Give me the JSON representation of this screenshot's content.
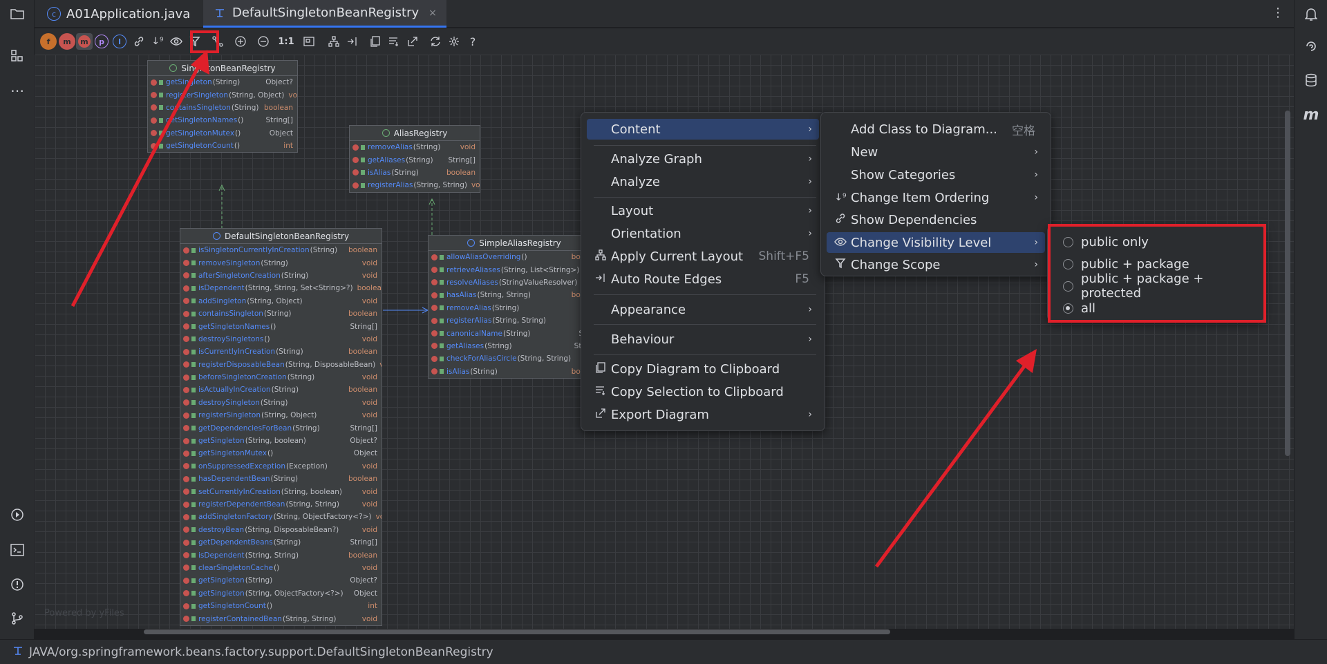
{
  "tabs": [
    {
      "label": "A01Application.java",
      "icon": "java-class-icon"
    },
    {
      "label": "DefaultSingletonBeanRegistry",
      "icon": "diagram-icon",
      "close": "×"
    }
  ],
  "toolbar": {
    "icons": [
      "fields-icon",
      "constructors-icon",
      "methods-icon",
      "properties-icon",
      "inner-classes-icon",
      "link-icon",
      "sort-icon",
      "visibility-icon",
      "filter-icon",
      "route-icon",
      "zoom-in-icon",
      "zoom-out-icon",
      "actual-size-icon",
      "fit-content-icon",
      "layout-icon",
      "route-edges-icon",
      "copy-icon",
      "copy-selection-icon",
      "export-icon",
      "refresh-icon",
      "settings-icon",
      "help-icon"
    ],
    "actual_size_label": "1:1",
    "help_label": "?"
  },
  "watermark": "Powered by yFiles",
  "classes": [
    {
      "name": "SingletonBeanRegistry",
      "kind": "interface",
      "methods": [
        {
          "name": "getSingleton",
          "params": "(String)",
          "ret": "Object?"
        },
        {
          "name": "registerSingleton",
          "params": "(String, Object)",
          "ret": "void"
        },
        {
          "name": "containsSingleton",
          "params": "(String)",
          "ret": "boolean"
        },
        {
          "name": "getSingletonNames",
          "params": "()",
          "ret": "String[]"
        },
        {
          "name": "getSingletonMutex",
          "params": "()",
          "ret": "Object"
        },
        {
          "name": "getSingletonCount",
          "params": "()",
          "ret": "int"
        }
      ]
    },
    {
      "name": "AliasRegistry",
      "kind": "interface",
      "methods": [
        {
          "name": "removeAlias",
          "params": "(String)",
          "ret": "void"
        },
        {
          "name": "getAliases",
          "params": "(String)",
          "ret": "String[]"
        },
        {
          "name": "isAlias",
          "params": "(String)",
          "ret": "boolean"
        },
        {
          "name": "registerAlias",
          "params": "(String, String)",
          "ret": "void"
        }
      ]
    },
    {
      "name": "DefaultSingletonBeanRegistry",
      "kind": "class",
      "methods": [
        {
          "name": "isSingletonCurrentlyInCreation",
          "params": "(String)",
          "ret": "boolean"
        },
        {
          "name": "removeSingleton",
          "params": "(String)",
          "ret": "void"
        },
        {
          "name": "afterSingletonCreation",
          "params": "(String)",
          "ret": "void"
        },
        {
          "name": "isDependent",
          "params": "(String, String, Set<String>?)",
          "ret": "boolean"
        },
        {
          "name": "addSingleton",
          "params": "(String, Object)",
          "ret": "void"
        },
        {
          "name": "containsSingleton",
          "params": "(String)",
          "ret": "boolean"
        },
        {
          "name": "getSingletonNames",
          "params": "()",
          "ret": "String[]"
        },
        {
          "name": "destroySingletons",
          "params": "()",
          "ret": "void"
        },
        {
          "name": "isCurrentlyInCreation",
          "params": "(String)",
          "ret": "boolean"
        },
        {
          "name": "registerDisposableBean",
          "params": "(String, DisposableBean)",
          "ret": "void"
        },
        {
          "name": "beforeSingletonCreation",
          "params": "(String)",
          "ret": "void"
        },
        {
          "name": "isActuallyInCreation",
          "params": "(String)",
          "ret": "boolean"
        },
        {
          "name": "destroySingleton",
          "params": "(String)",
          "ret": "void"
        },
        {
          "name": "registerSingleton",
          "params": "(String, Object)",
          "ret": "void"
        },
        {
          "name": "getDependenciesForBean",
          "params": "(String)",
          "ret": "String[]"
        },
        {
          "name": "getSingleton",
          "params": "(String, boolean)",
          "ret": "Object?"
        },
        {
          "name": "getSingletonMutex",
          "params": "()",
          "ret": "Object"
        },
        {
          "name": "onSuppressedException",
          "params": "(Exception)",
          "ret": "void"
        },
        {
          "name": "hasDependentBean",
          "params": "(String)",
          "ret": "boolean"
        },
        {
          "name": "setCurrentlyInCreation",
          "params": "(String, boolean)",
          "ret": "void"
        },
        {
          "name": "registerDependentBean",
          "params": "(String, String)",
          "ret": "void"
        },
        {
          "name": "addSingletonFactory",
          "params": "(String, ObjectFactory<?>)",
          "ret": "void"
        },
        {
          "name": "destroyBean",
          "params": "(String, DisposableBean?)",
          "ret": "void"
        },
        {
          "name": "getDependentBeans",
          "params": "(String)",
          "ret": "String[]"
        },
        {
          "name": "isDependent",
          "params": "(String, String)",
          "ret": "boolean"
        },
        {
          "name": "clearSingletonCache",
          "params": "()",
          "ret": "void"
        },
        {
          "name": "getSingleton",
          "params": "(String)",
          "ret": "Object?"
        },
        {
          "name": "getSingleton",
          "params": "(String, ObjectFactory<?>)",
          "ret": "Object"
        },
        {
          "name": "getSingletonCount",
          "params": "()",
          "ret": "int"
        },
        {
          "name": "registerContainedBean",
          "params": "(String, String)",
          "ret": "void"
        }
      ]
    },
    {
      "name": "SimpleAliasRegistry",
      "kind": "class",
      "methods": [
        {
          "name": "allowAliasOverriding",
          "params": "()",
          "ret": "boolea"
        },
        {
          "name": "retrieveAliases",
          "params": "(String, List<String>)",
          "ret": "voi"
        },
        {
          "name": "resolveAliases",
          "params": "(StringValueResolver)",
          "ret": "voi"
        },
        {
          "name": "hasAlias",
          "params": "(String, String)",
          "ret": "boolea"
        },
        {
          "name": "removeAlias",
          "params": "(String)",
          "ret": "voi"
        },
        {
          "name": "registerAlias",
          "params": "(String, String)",
          "ret": "voi"
        },
        {
          "name": "canonicalName",
          "params": "(String)",
          "ret": "Strin"
        },
        {
          "name": "getAliases",
          "params": "(String)",
          "ret": "String"
        },
        {
          "name": "checkForAliasCircle",
          "params": "(String, String)",
          "ret": "voi"
        },
        {
          "name": "isAlias",
          "params": "(String)",
          "ret": "boolea"
        }
      ]
    }
  ],
  "context_menu": {
    "items": [
      {
        "label": "Content",
        "submenu": true,
        "selected": true
      },
      {
        "label": "Analyze Graph",
        "submenu": true
      },
      {
        "label": "Analyze",
        "submenu": true
      },
      {
        "label": "Layout",
        "submenu": true
      },
      {
        "label": "Orientation",
        "submenu": true
      },
      {
        "label": "Apply Current Layout",
        "shortcut": "Shift+F5",
        "icon": "layout-icon"
      },
      {
        "label": "Auto Route Edges",
        "shortcut": "F5",
        "icon": "route-edges-icon"
      },
      {
        "label": "Appearance",
        "submenu": true
      },
      {
        "label": "Behaviour",
        "submenu": true
      },
      {
        "label": "Copy Diagram to Clipboard",
        "icon": "copy-icon"
      },
      {
        "label": "Copy Selection to Clipboard",
        "icon": "copy-selection-icon"
      },
      {
        "label": "Export Diagram",
        "submenu": true,
        "icon": "export-icon"
      }
    ]
  },
  "content_submenu": {
    "items": [
      {
        "label": "Add Class to Diagram...",
        "shortcut": "空格"
      },
      {
        "label": "New",
        "submenu": true
      },
      {
        "label": "Show Categories",
        "submenu": true
      },
      {
        "label": "Change Item Ordering",
        "submenu": true,
        "icon": "sort-icon"
      },
      {
        "label": "Show Dependencies",
        "icon": "link-icon"
      },
      {
        "label": "Change Visibility Level",
        "submenu": true,
        "selected": true,
        "icon": "visibility-icon"
      },
      {
        "label": "Change Scope",
        "submenu": true,
        "icon": "filter-icon"
      }
    ]
  },
  "visibility_submenu": {
    "options": [
      {
        "label": "public only",
        "checked": false
      },
      {
        "label": "public + package",
        "checked": false
      },
      {
        "label": "public + package + protected",
        "checked": false
      },
      {
        "label": "all",
        "checked": true
      }
    ]
  },
  "status_bar": {
    "path": "JAVA/org.springframework.beans.factory.support.DefaultSingletonBeanRegistry"
  },
  "colors": {
    "accent": "#3574f0",
    "highlight": "#e0202a",
    "method_name": "#548af7",
    "keyword": "#cf8e6d"
  }
}
